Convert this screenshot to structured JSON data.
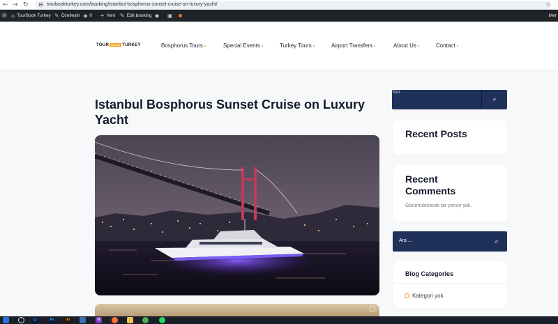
{
  "browser": {
    "url": "tourbookturkey.com/booking/istanbul-bosphorus-sunset-cruise-on-luxury-yacht/",
    "back_icon": "←",
    "forward_icon": "→",
    "reload_icon": "↻",
    "lock_icon": "⊟",
    "star_icon": "☆"
  },
  "admin_bar": {
    "wp_icon": "Ⓦ",
    "site_name": "TourBook Turkey",
    "customize": "Özelleştir",
    "comments_count": "0",
    "new": "Yeni",
    "edit": "Edit booking",
    "right_text": "Mer"
  },
  "site": {
    "logo_left": "TOUR",
    "logo_mid": "BOOK",
    "logo_right": "TURKEY",
    "menu": [
      "Bosphorus Tours",
      "Special Events",
      "Turkey Tours",
      "Airport Transfers",
      "About Us",
      "Contact"
    ],
    "accent_color": "#f6a21c",
    "navy_color": "#1f3059"
  },
  "post": {
    "title": "Istanbul Bosphorus Sunset Cruise on Luxury Yacht"
  },
  "sidebar": {
    "search1_placeholder": "Ara",
    "search_icon": "🔍",
    "recent_posts_title": "Recent Posts",
    "recent_comments_title": "Recent Comments",
    "no_comments": "Görüntülenecek bir yorum yok.",
    "search2_placeholder": "Ara ...",
    "blog_categories_title": "Blog Categories",
    "category_item": "Kategori yok"
  },
  "taskbar": {
    "apps": [
      "Lr",
      "Ps",
      "Ai",
      "N"
    ]
  }
}
